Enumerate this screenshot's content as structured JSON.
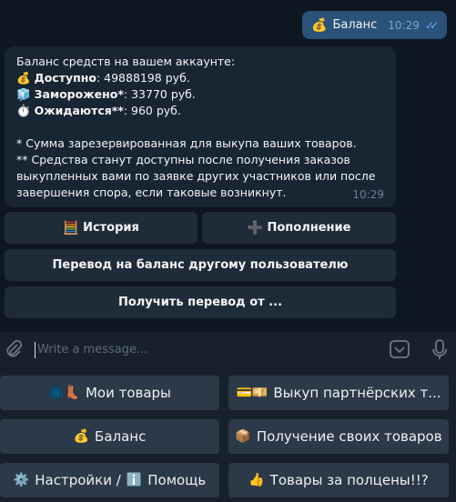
{
  "outgoing": {
    "icon": "💰",
    "text": "Баланс",
    "time": "10:29"
  },
  "incoming": {
    "intro": "Баланс средств на вашем аккаунте:",
    "available_icon": "💰",
    "available_label": "Доступно",
    "available_value": ": 49888198 руб.",
    "frozen_icon": "🧊",
    "frozen_label": "Заморожено*",
    "frozen_value": ": 33770 руб.",
    "pending_icon": "⏱️",
    "pending_label": "Ожидаются**",
    "pending_value": ": 960 руб.",
    "note1": "* Сумма зарезервированная для выкупа ваших товаров.",
    "note2_line1": "** Средства станут доступны после получения заказов",
    "note2_line2": "выкупленных вами по заявке других участников или после",
    "note2_line3": "завершения спора, если таковые возникнут.",
    "time": "10:29"
  },
  "inline_buttons": {
    "history": {
      "icon": "🧮",
      "label": "История"
    },
    "topup": {
      "icon": "➕",
      "label": "Пополнение"
    },
    "transfer": "Перевод на баланс другому пользователю",
    "receive": "Получить перевод от ..."
  },
  "input": {
    "placeholder": "Write a message..."
  },
  "keyboard": {
    "my_goods": {
      "icon": "🧥👢",
      "label": "Мои товары"
    },
    "partner": {
      "icon": "💳💴",
      "label": "Выкуп партнёрских т..."
    },
    "balance": {
      "icon": "💰",
      "label": "Баланс"
    },
    "receive_goods": {
      "icon": "📦",
      "label": "Получение своих товаров"
    },
    "settings": {
      "icon": "⚙️",
      "label": "Настройки / ",
      "icon2": "ℹ️",
      "label2": "Помощь"
    },
    "half_price": {
      "icon": "👍",
      "label": "Товары за полцены!!?"
    }
  }
}
